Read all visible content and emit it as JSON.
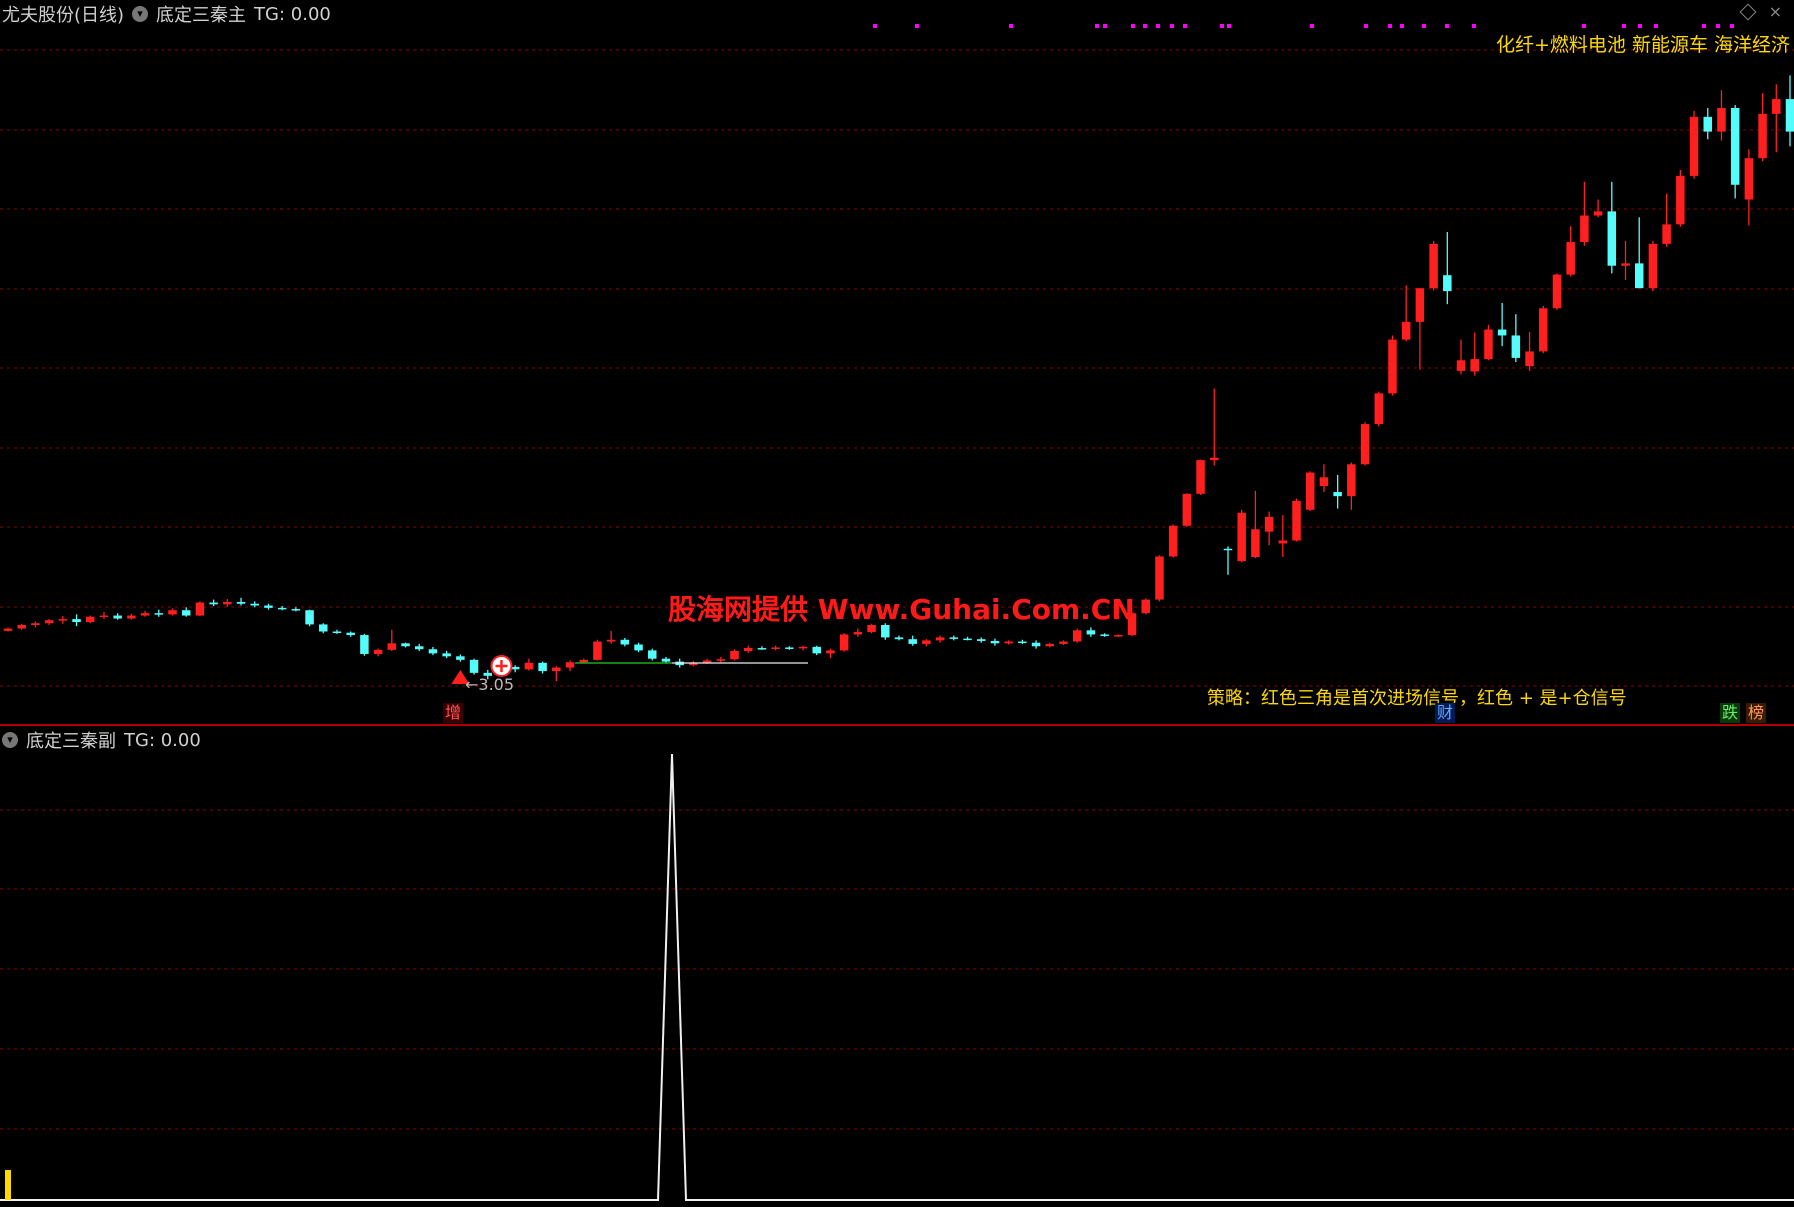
{
  "main_title": {
    "stock": "尤夫股份(日线)",
    "indicator": "底定三秦主",
    "tg": "TG: 0.00"
  },
  "sub_title": {
    "indicator": "底定三秦副",
    "tg": "TG: 0.00"
  },
  "sector_text": "化纤+燃料电池 新能源车 海洋经济",
  "watermark": "股海网提供 Www.Guhai.Com.CN",
  "strategy_text": "策略：红色三角是首次进场信号，红色 + 是+仓信号",
  "low_label": "←3.05",
  "tags": {
    "zeng": "增",
    "cai": "财",
    "die": "跌",
    "bang": "榜"
  },
  "window_icons": {
    "diamond": "diamond-icon",
    "close": "close-icon"
  },
  "colors": {
    "up": "#ff1f1f",
    "down": "#54fcfc",
    "grid": "#8a0000",
    "text_yellow": "#ffd800",
    "signal_magenta": "#ff00ff"
  },
  "chart_data": {
    "type": "candlestick",
    "candles_note": "daily OHLC in price-relative units (approximate, read from screenshot)",
    "candles": [
      [
        40.0,
        40.6,
        39.9,
        40.4
      ],
      [
        40.4,
        41.2,
        40.2,
        41.0
      ],
      [
        41.0,
        41.6,
        40.6,
        41.3
      ],
      [
        41.3,
        42.0,
        41.0,
        41.8
      ],
      [
        41.8,
        42.5,
        41.2,
        42.0
      ],
      [
        42.0,
        42.8,
        40.8,
        41.5
      ],
      [
        41.5,
        42.6,
        41.3,
        42.4
      ],
      [
        42.4,
        43.2,
        42.0,
        42.6
      ],
      [
        42.6,
        43.0,
        41.9,
        42.1
      ],
      [
        42.1,
        42.9,
        41.9,
        42.6
      ],
      [
        42.6,
        43.4,
        42.4,
        43.0
      ],
      [
        43.0,
        43.6,
        42.4,
        42.8
      ],
      [
        42.8,
        43.8,
        42.6,
        43.5
      ],
      [
        43.5,
        44.0,
        42.4,
        42.6
      ],
      [
        42.6,
        45.0,
        42.5,
        44.8
      ],
      [
        44.8,
        45.3,
        44.2,
        44.5
      ],
      [
        44.5,
        45.4,
        44.1,
        44.9
      ],
      [
        44.9,
        45.6,
        44.3,
        44.6
      ],
      [
        44.6,
        45.0,
        44.0,
        44.3
      ],
      [
        44.3,
        44.6,
        43.6,
        43.9
      ],
      [
        43.9,
        44.2,
        43.5,
        43.7
      ],
      [
        43.7,
        44.0,
        43.3,
        43.5
      ],
      [
        43.5,
        43.6,
        40.8,
        41.1
      ],
      [
        41.1,
        41.3,
        39.6,
        39.9
      ],
      [
        39.9,
        40.2,
        39.5,
        39.7
      ],
      [
        39.7,
        39.9,
        39.0,
        39.3
      ],
      [
        39.3,
        39.5,
        35.8,
        36.1
      ],
      [
        36.1,
        37.0,
        35.7,
        36.8
      ],
      [
        36.8,
        40.2,
        36.6,
        37.9
      ],
      [
        37.9,
        38.0,
        37.2,
        37.4
      ],
      [
        37.4,
        37.8,
        36.6,
        36.9
      ],
      [
        36.9,
        37.3,
        35.9,
        36.2
      ],
      [
        36.2,
        36.6,
        35.4,
        35.7
      ],
      [
        35.7,
        36.0,
        34.8,
        35.1
      ],
      [
        35.1,
        35.3,
        32.6,
        32.9
      ],
      [
        32.9,
        33.4,
        31.8,
        32.4
      ],
      [
        32.4,
        34.4,
        32.2,
        33.9
      ],
      [
        33.9,
        34.2,
        33.0,
        33.5
      ],
      [
        33.5,
        35.3,
        33.3,
        34.6
      ],
      [
        34.6,
        34.8,
        32.8,
        33.2
      ],
      [
        33.2,
        34.0,
        31.5,
        33.8
      ],
      [
        33.8,
        35.0,
        33.2,
        34.7
      ],
      [
        34.7,
        35.3,
        34.5,
        35.1
      ],
      [
        35.1,
        38.5,
        35.0,
        38.2
      ],
      [
        38.2,
        40.0,
        37.8,
        38.5
      ],
      [
        38.5,
        38.8,
        37.4,
        37.7
      ],
      [
        37.7,
        38.0,
        36.4,
        36.7
      ],
      [
        36.7,
        37.0,
        35.0,
        35.3
      ],
      [
        35.3,
        35.6,
        34.5,
        34.8
      ],
      [
        34.8,
        35.3,
        33.8,
        34.2
      ],
      [
        34.2,
        34.9,
        34.0,
        34.6
      ],
      [
        34.6,
        35.3,
        34.4,
        35.0
      ],
      [
        35.0,
        35.6,
        34.7,
        35.2
      ],
      [
        35.2,
        36.9,
        35.0,
        36.6
      ],
      [
        36.6,
        37.5,
        36.3,
        37.1
      ],
      [
        37.1,
        37.4,
        36.8,
        37.0
      ],
      [
        37.0,
        37.5,
        36.7,
        37.2
      ],
      [
        37.2,
        37.4,
        36.8,
        37.1
      ],
      [
        37.1,
        37.5,
        36.7,
        37.3
      ],
      [
        37.3,
        37.5,
        35.9,
        36.2
      ],
      [
        36.2,
        37.0,
        35.4,
        36.7
      ],
      [
        36.7,
        39.6,
        36.5,
        39.4
      ],
      [
        39.4,
        40.4,
        39.0,
        39.8
      ],
      [
        39.8,
        41.2,
        39.6,
        41.0
      ],
      [
        41.0,
        41.3,
        38.5,
        38.9
      ],
      [
        38.9,
        39.2,
        38.4,
        38.6
      ],
      [
        38.6,
        39.2,
        37.5,
        37.8
      ],
      [
        37.8,
        38.6,
        37.4,
        38.4
      ],
      [
        38.4,
        39.2,
        38.0,
        38.9
      ],
      [
        38.9,
        39.2,
        38.4,
        38.7
      ],
      [
        38.7,
        39.0,
        38.4,
        38.6
      ],
      [
        38.6,
        38.9,
        38.0,
        38.3
      ],
      [
        38.3,
        38.7,
        37.5,
        37.9
      ],
      [
        37.9,
        38.4,
        37.7,
        38.2
      ],
      [
        38.2,
        38.5,
        37.8,
        38.0
      ],
      [
        38.0,
        38.4,
        37.0,
        37.4
      ],
      [
        37.4,
        38.0,
        37.2,
        37.8
      ],
      [
        37.8,
        38.4,
        37.6,
        38.2
      ],
      [
        38.2,
        40.4,
        38.0,
        40.1
      ],
      [
        40.1,
        40.6,
        39.0,
        39.4
      ],
      [
        39.4,
        39.6,
        39.0,
        39.2
      ],
      [
        39.2,
        39.4,
        39.0,
        39.3
      ],
      [
        39.3,
        43.2,
        39.1,
        43.0
      ],
      [
        43.0,
        45.5,
        42.8,
        45.3
      ],
      [
        45.3,
        52.8,
        45.0,
        52.6
      ],
      [
        52.6,
        58.0,
        52.4,
        57.8
      ],
      [
        57.8,
        63.3,
        57.6,
        63.2
      ],
      [
        63.2,
        69.0,
        63.0,
        68.9
      ],
      [
        68.9,
        81.0,
        68.0,
        69.3
      ],
      [
        53.9,
        54.3,
        49.5,
        53.8
      ],
      [
        51.8,
        60.5,
        51.6,
        60.0
      ],
      [
        52.5,
        63.7,
        52.3,
        57.2
      ],
      [
        56.8,
        60.2,
        54.5,
        59.3
      ],
      [
        54.8,
        59.6,
        52.5,
        55.3
      ],
      [
        55.3,
        62.4,
        55.1,
        62.0
      ],
      [
        60.5,
        67.0,
        60.3,
        66.8
      ],
      [
        64.5,
        68.2,
        63.5,
        66.0
      ],
      [
        63.5,
        66.4,
        60.7,
        62.8
      ],
      [
        62.8,
        68.5,
        60.5,
        68.2
      ],
      [
        68.2,
        75.3,
        68.0,
        75.0
      ],
      [
        75.0,
        80.5,
        74.6,
        80.2
      ],
      [
        80.2,
        90.0,
        79.8,
        89.3
      ],
      [
        89.3,
        98.5,
        89.0,
        92.3
      ],
      [
        92.3,
        98.0,
        84.2,
        98.0
      ],
      [
        98.0,
        106.0,
        97.6,
        105.5
      ],
      [
        100.2,
        107.5,
        95.3,
        97.5
      ],
      [
        84.0,
        89.3,
        83.4,
        85.8
      ],
      [
        83.9,
        90.5,
        83.2,
        86.0
      ],
      [
        86.0,
        91.8,
        85.8,
        91.0
      ],
      [
        91.0,
        95.5,
        88.2,
        90.0
      ],
      [
        90.0,
        93.6,
        85.5,
        86.2
      ],
      [
        84.8,
        90.6,
        84.0,
        87.3
      ],
      [
        87.3,
        95.0,
        87.0,
        94.6
      ],
      [
        94.6,
        100.5,
        94.3,
        100.3
      ],
      [
        100.3,
        108.5,
        100.0,
        105.8
      ],
      [
        105.8,
        116.0,
        105.2,
        110.3
      ],
      [
        110.3,
        113.0,
        110.0,
        111.0
      ],
      [
        111.0,
        116.0,
        100.5,
        101.8
      ],
      [
        101.8,
        106.0,
        99.4,
        102.2
      ],
      [
        102.2,
        110.0,
        99.5,
        98.0
      ],
      [
        98.0,
        106.0,
        97.5,
        105.5
      ],
      [
        105.5,
        114.0,
        105.0,
        108.8
      ],
      [
        108.8,
        118.0,
        108.4,
        117.0
      ],
      [
        117.0,
        128.0,
        116.5,
        127.0
      ],
      [
        127.0,
        128.5,
        123.2,
        124.5
      ],
      [
        124.5,
        131.5,
        123.0,
        128.5
      ],
      [
        128.5,
        129.0,
        113.2,
        115.5
      ],
      [
        113.0,
        121.5,
        108.6,
        120.0
      ],
      [
        120.0,
        131.0,
        119.5,
        127.5
      ],
      [
        127.5,
        132.5,
        121.0,
        130.0
      ],
      [
        130.0,
        134.0,
        122.0,
        124.5
      ]
    ],
    "low_marker_value": 3.05,
    "entry_signal": "red-triangle",
    "add_signal": "red-plus",
    "sub_indicator": {
      "type": "line",
      "baseline": 0,
      "spike_value": 1
    }
  }
}
